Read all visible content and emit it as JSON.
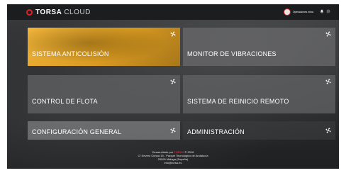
{
  "header": {
    "brand_name": "TORSA",
    "brand_sub": "CLOUD",
    "user_name": "Operaciones mina",
    "notification_icon": "bell-icon",
    "settings_icon": "gear-icon"
  },
  "tiles": [
    {
      "label": "SISTEMA ANTICOLISIÓN",
      "icon": "fan-icon"
    },
    {
      "label": "MONITOR DE VIBRACIONES",
      "icon": "fan-icon"
    },
    {
      "label": "CONTROL DE FLOTA",
      "icon": "fan-icon"
    },
    {
      "label": "SISTEMA DE REINICIO REMOTO",
      "icon": "fan-icon"
    },
    {
      "label": "CONFIGURACIÓN GENERAL",
      "icon": "fan-icon"
    },
    {
      "label": "ADMINISTRACIÓN",
      "icon": "fan-icon"
    }
  ],
  "footer": {
    "developed_by": "Desarrollado por",
    "company": "TORSA",
    "year": "© 2018",
    "address_line1": "C/ Severo Ochoa 19 - Parque Tecnológico de Andalucía",
    "address_line2": "29590 Málaga (España)",
    "email": "info@torsa.es"
  },
  "colors": {
    "accent": "#d9262c",
    "highlight_tile": "#e6a52b",
    "header_bg": "#1c1d1f"
  }
}
